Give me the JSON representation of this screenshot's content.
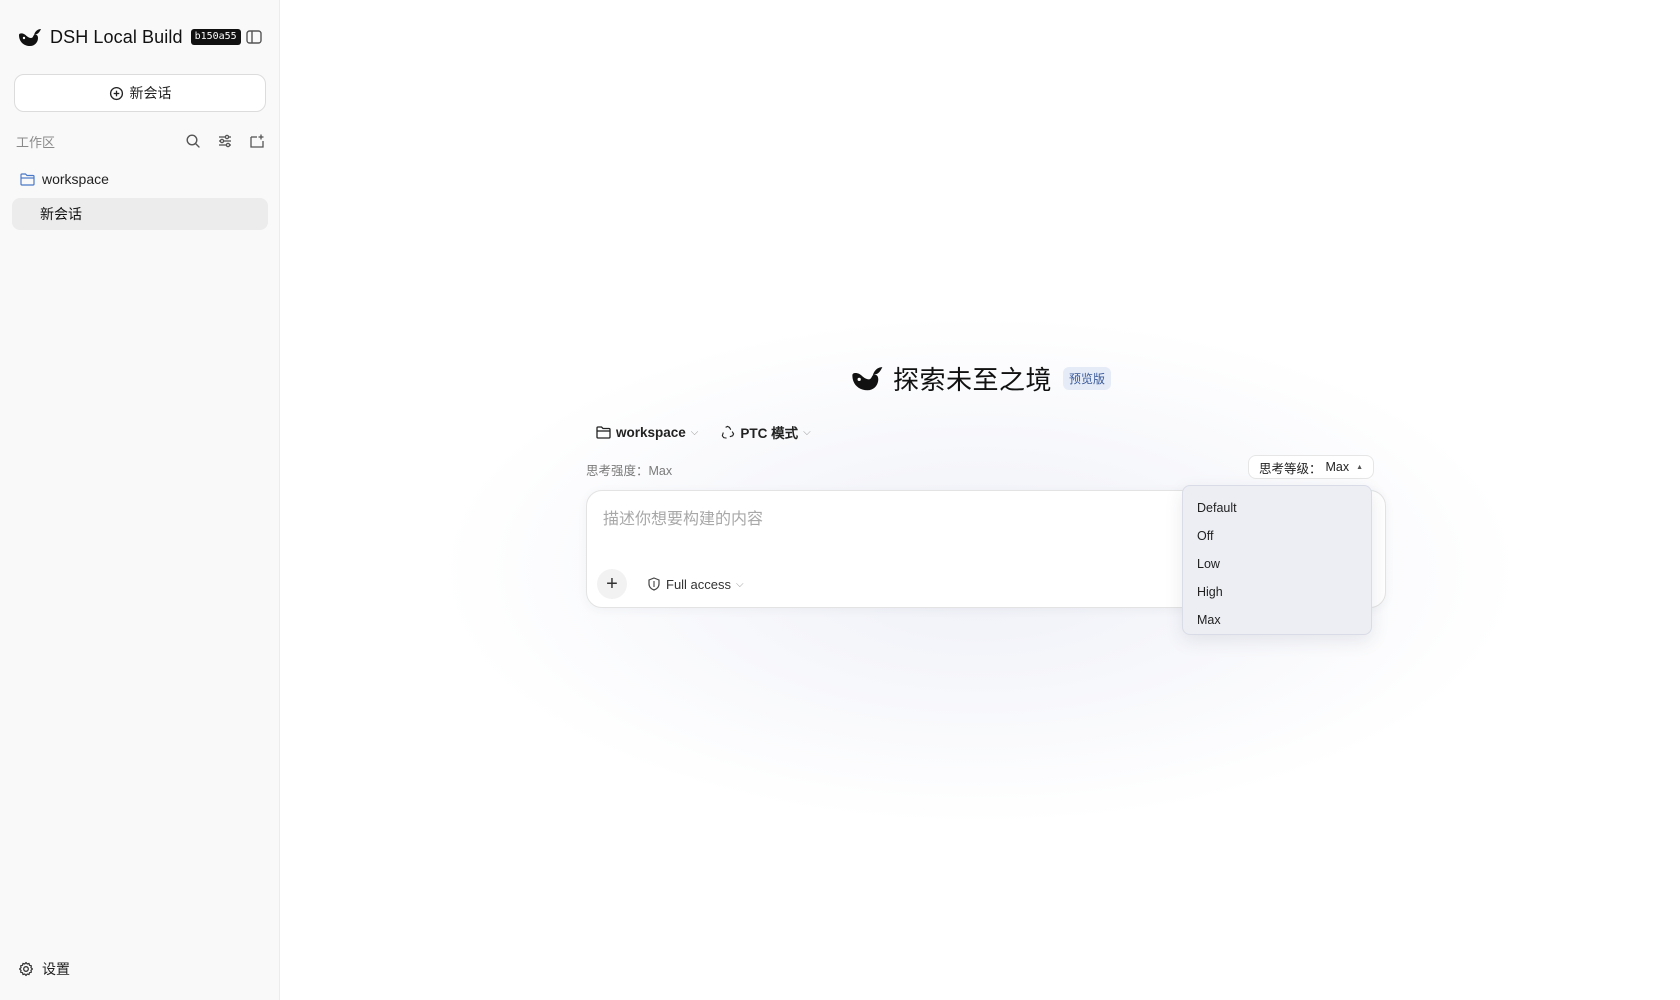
{
  "sidebar": {
    "brand": {
      "title": "DSH Local Build",
      "build_hash": "b150a55"
    },
    "new_chat_label": "新会话",
    "section_label": "工作区",
    "tree": {
      "folder_label": "workspace",
      "session_label": "新会话"
    },
    "settings_label": "设置"
  },
  "main": {
    "hero": {
      "title": "探索未至之境",
      "badge": "预览版"
    },
    "selectors": {
      "workspace_label": "workspace",
      "mode_label": "PTC 模式"
    },
    "effort_text": "思考强度：Max",
    "level_pill": {
      "label": "思考等级：",
      "value": "Max"
    },
    "composer": {
      "placeholder": "描述你想要构建的内容",
      "access_label": "Full access"
    },
    "dropdown_options": [
      "Default",
      "Off",
      "Low",
      "High",
      "Max"
    ]
  },
  "icons": {
    "brand": "whale-logo-icon",
    "collapse": "sidebar-toggle-icon",
    "new_chat": "plus-circle-icon",
    "search": "search-icon",
    "filter": "sliders-icon",
    "new_folder": "folder-plus-icon",
    "folder": "folder-icon",
    "settings": "gear-icon",
    "mode": "recycle-icon",
    "access": "shield-icon",
    "add": "plus-icon"
  },
  "colors": {
    "sidebar_bg": "#f9f9f9",
    "active_session_bg": "#ececec",
    "preview_badge_bg": "#e6ecf7",
    "preview_badge_text": "#3a5a9a",
    "dropdown_bg": "#eceef4",
    "build_badge_bg": "#111111"
  }
}
